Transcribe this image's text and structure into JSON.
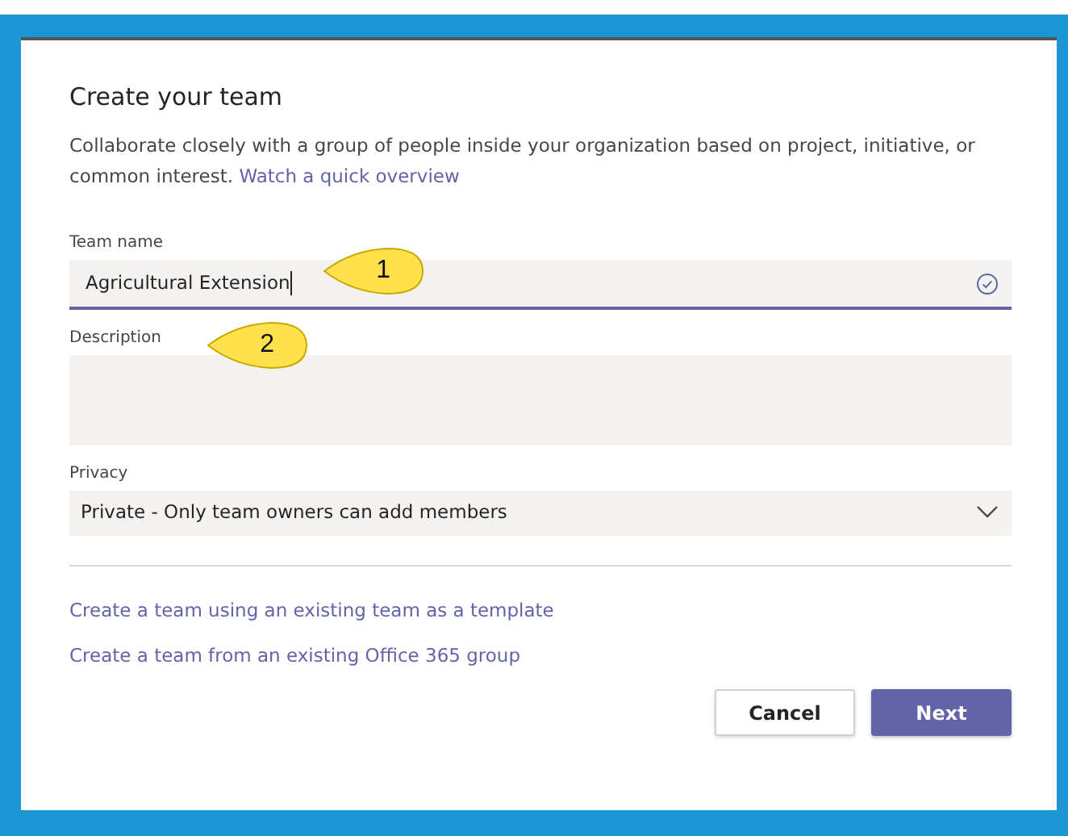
{
  "dialog": {
    "title": "Create your team",
    "description": "Collaborate closely with a group of people inside your organization based on project, initiative, or common interest.",
    "overview_link": "Watch a quick overview"
  },
  "fields": [
    {
      "kind": "text",
      "label": "Team name",
      "value": "Agricultural Extension",
      "focused": true
    },
    {
      "kind": "textarea",
      "label": "Description",
      "focused": false
    },
    {
      "kind": "select",
      "label": "Privacy",
      "value": "Private - Only team owners can add members",
      "focused": false
    }
  ],
  "links": [
    "Create a team using an existing team as a template",
    "Create a team from an existing Office 365 group"
  ],
  "buttons": [
    {
      "label": "Cancel",
      "kind": "secondary"
    },
    {
      "label": "Next",
      "kind": "primary"
    }
  ],
  "callouts": [
    {
      "label": "1"
    },
    {
      "label": "2"
    }
  ]
}
